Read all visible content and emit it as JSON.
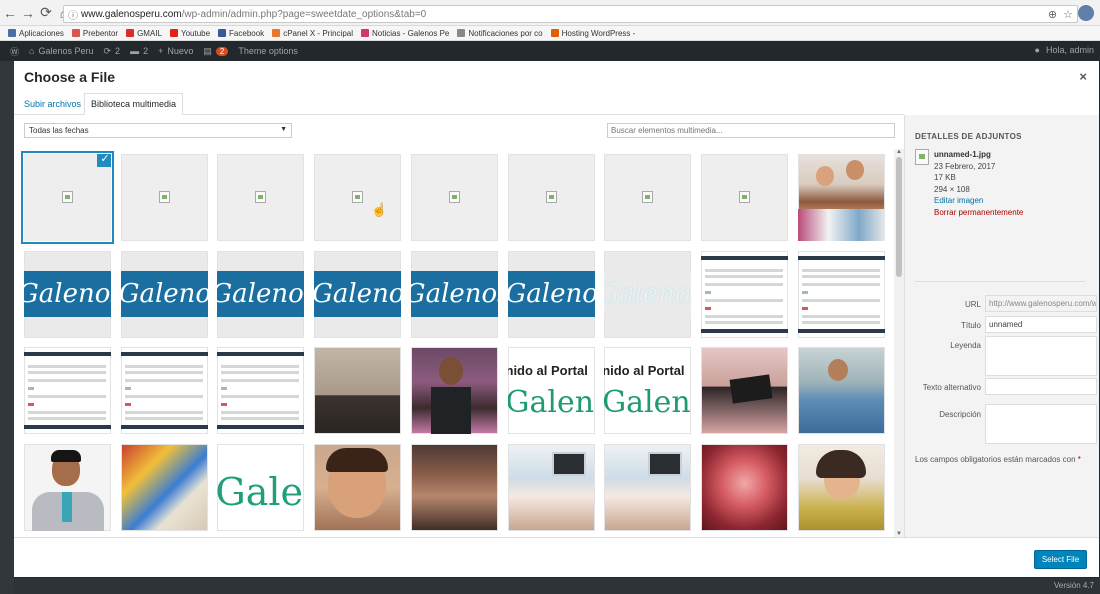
{
  "browser": {
    "url_host": "www.galenosperu.com",
    "url_path": "/wp-admin/admin.php?page=sweetdate_options&tab=0",
    "bookmarks": [
      {
        "label": "Aplicaciones",
        "color": "#4a6fa5"
      },
      {
        "label": "Prebentor",
        "color": "#d9534f"
      },
      {
        "label": "GMAIL",
        "color": "#d93025"
      },
      {
        "label": "Youtube",
        "color": "#e62117"
      },
      {
        "label": "Facebook",
        "color": "#3b5998"
      },
      {
        "label": "cPanel X - Principal",
        "color": "#e8762b"
      },
      {
        "label": "Noticias - Galenos Pe",
        "color": "#d6336c"
      },
      {
        "label": "Notificaciones por co",
        "color": "#888888"
      },
      {
        "label": "Hosting WordPress -",
        "color": "#e65c00"
      }
    ]
  },
  "adminbar": {
    "site": "Galenos Peru",
    "updates": "2",
    "comments": "2",
    "new": "Nuevo",
    "notif_count": "2",
    "theme_options": "Theme options",
    "greeting": "Hola, admin"
  },
  "modal": {
    "title": "Choose a File",
    "close": "×",
    "tabs": {
      "upload": "Subir archivos",
      "library": "Biblioteca multimedia"
    },
    "date_filter": "Todas las fechas",
    "search_placeholder": "Buscar elementos multimedia...",
    "select_button": "Select File",
    "checkmark": "✓"
  },
  "media_tiles": [
    "broken",
    "broken",
    "broken",
    "broken",
    "broken",
    "broken",
    "broken",
    "broken",
    "family",
    "banner",
    "banner",
    "banner",
    "banner",
    "banner",
    "banner",
    "banner-light",
    "screenshot",
    "screenshot",
    "screenshot",
    "screenshot",
    "screenshot",
    "room",
    "boy",
    "portal",
    "portal",
    "selfie",
    "doctor",
    "man",
    "toys",
    "galen",
    "kid",
    "body",
    "scan",
    "scan",
    "endoscope",
    "woman"
  ],
  "tile_text": {
    "banner": "Galenos",
    "portal_line1": "nido al Portal",
    "portal_line2": "Galenos",
    "galen": "Galen"
  },
  "attachment": {
    "heading": "DETALLES DE ADJUNTOS",
    "filename": "unnamed-1.jpg",
    "date": "23 Febrero, 2017",
    "size": "17 KB",
    "dimensions": "294 × 108",
    "edit_link": "Editar imagen",
    "delete_link": "Borrar permanentemente",
    "fields": {
      "url_label": "URL",
      "url_value": "http://www.galenosperu.com/w",
      "title_label": "Título",
      "title_value": "unnamed",
      "caption_label": "Leyenda",
      "alt_label": "Texto alternativo",
      "description_label": "Descripción"
    },
    "required_note": "Los campos obligatorios están marcados con",
    "required_star": "*"
  },
  "footer": {
    "version": "Versión 4.7"
  }
}
